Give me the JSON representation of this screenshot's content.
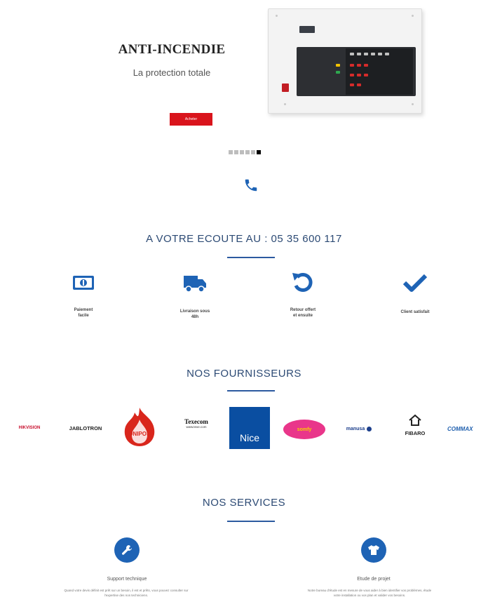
{
  "hero": {
    "title": "ANTI-INCENDIE",
    "subtitle": "La protection totale",
    "button_label": "Acheter",
    "carousel": {
      "count": 6,
      "active_index": 5
    }
  },
  "contact": {
    "icon": "phone-icon",
    "text": "A VOTRE ECOUTE AU : 05 35 600 117"
  },
  "features": [
    {
      "icon": "banknote-icon",
      "label_line1": "Paiement",
      "label_line2": "facile"
    },
    {
      "icon": "truck-icon",
      "label_line1": "Livraison sous",
      "label_line2": "48h"
    },
    {
      "icon": "undo-icon",
      "label_line1": "Retour offert",
      "label_line2": "et ensuite"
    },
    {
      "icon": "check-icon",
      "label_line1": "Client satisfait",
      "label_line2": ""
    }
  ],
  "suppliers": {
    "heading": "NOS FOURNISSEURS",
    "logos": [
      {
        "name": "HIKVISION",
        "color": "#c8102e"
      },
      {
        "name": "JABLOTRON",
        "color": "#222222"
      },
      {
        "name": "UNIPOS",
        "color": "#d9261c"
      },
      {
        "name": "Texecom",
        "sub": "www.texe.com",
        "color": "#111111"
      },
      {
        "name": "Nice",
        "color": "#0a4ea1"
      },
      {
        "name": "somfy",
        "color": "#f39200"
      },
      {
        "name": "manusa",
        "color": "#1d3f8c"
      },
      {
        "name": "FIBARO",
        "color": "#222222"
      },
      {
        "name": "COMMAX",
        "color": "#1f5fae"
      }
    ]
  },
  "services": {
    "heading": "NOS SERVICES",
    "items": [
      {
        "icon": "wrench-icon",
        "title": "Support technique",
        "desc_line1": "Quand votre devis définit est prêt sur un besoin, il est et prêts, vous pouvez consulter sur",
        "desc_line2": "l'expertise des nos techniciens."
      },
      {
        "icon": "shirt-icon",
        "title": "Etude de projet",
        "desc_line1": "Notre bureau d'étude est en mesure de vous aider à bien identifier vos problèmes, étude",
        "desc_line2": "votre installation ou vos plan et valider vos besoins."
      }
    ]
  },
  "colors": {
    "accent": "#1e63b5",
    "heading": "#2c4a74",
    "button": "#d9141c"
  }
}
